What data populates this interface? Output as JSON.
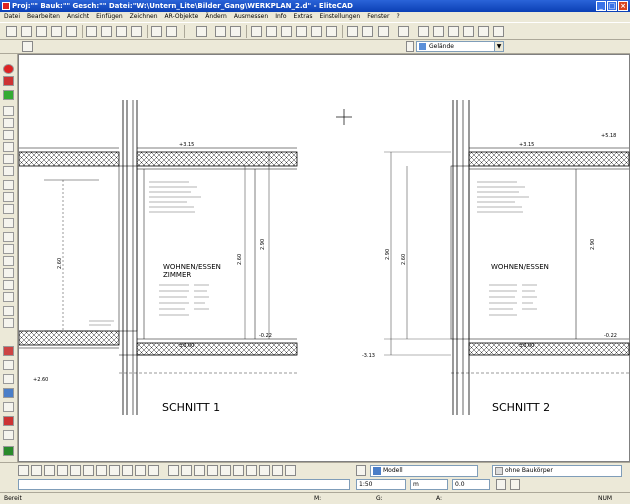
{
  "window": {
    "title": "Proj:\"\"  Bauk:\"\"  Gesch:\"\"  Datei:\"W:\\Untern_Lite\\Bilder_Gang\\WERKPLAN_2.d\"  - EliteCAD",
    "min": "_",
    "max": "□",
    "close": "×"
  },
  "menu": [
    "Datei",
    "Bearbeiten",
    "Ansicht",
    "Einfügen",
    "Zeichnen",
    "AR-Objekte",
    "Ändern",
    "Ausmessen",
    "Info",
    "Extras",
    "Einstellungen",
    "Fenster",
    "?"
  ],
  "layer": {
    "value": "Gelände"
  },
  "drawing": {
    "left_title": "SCHNITT 1",
    "right_title": "SCHNITT 2",
    "left_room": "WOHNEN/ESSEN",
    "left_room2": "ZIMMER",
    "right_room": "WOHNEN/ESSEN",
    "dim_top_left": "+3.15",
    "dim_level": "+2.90",
    "dim_bottom": "±0.00",
    "dim_bottom_right": "-0.22",
    "dim_left": "+2.60",
    "dim_side1": "2.90",
    "dim_side2": "2.60",
    "dim_right_top": "+5.18",
    "dim_right_bot": "-3.13"
  },
  "bottom": {
    "model_label": "Modell",
    "body_label": "ohne Baukörper"
  },
  "inputs": {
    "scale": "1:50",
    "unit": "m",
    "angle": "0.0"
  },
  "status": {
    "ready": "Bereit",
    "m": "M:",
    "g": "G:",
    "a": "A:",
    "num": "NUM"
  }
}
